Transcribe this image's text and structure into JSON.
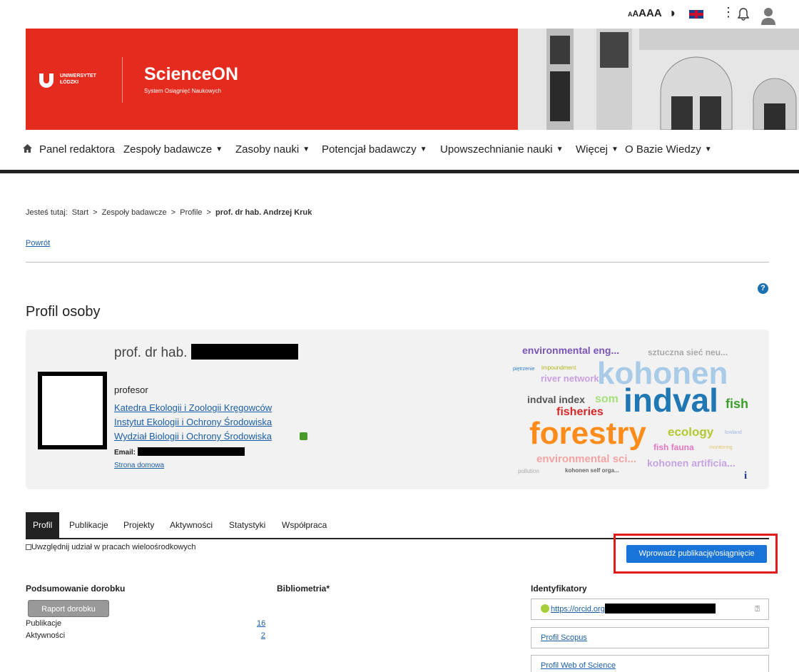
{
  "topbar": {
    "font_size": "AAA",
    "contrast": "◑",
    "menu": "⋮"
  },
  "header": {
    "logo_line1": "UNIWERSYTET",
    "logo_line2": "ŁÓDZKI",
    "brand": "ScienceON",
    "brand_sub": "System Osiągnięć Naukowych"
  },
  "nav": {
    "items": [
      {
        "label": "Panel redaktora",
        "caret": false
      },
      {
        "label": "Zespoły badawcze",
        "caret": true
      },
      {
        "label": "Zasoby nauki",
        "caret": true
      },
      {
        "label": "Potencjał badawczy",
        "caret": true
      },
      {
        "label": "Upowszechnianie nauki",
        "caret": true
      },
      {
        "label": "Więcej",
        "caret": true
      },
      {
        "label": "O Bazie Wiedzy",
        "caret": true
      }
    ]
  },
  "breadcrumb": {
    "prefix": "Jesteś tutaj:",
    "items": [
      "Start",
      "Zespoły badawcze",
      "Profile"
    ],
    "current": "prof. dr hab. Andrzej Kruk",
    "sep": ">"
  },
  "back_label": "Powrót",
  "page_title": "Profil osoby",
  "profile": {
    "name_prefix": "prof. dr hab.",
    "position": "profesor",
    "links": [
      "Katedra Ekologii i Zoologii Kręgowców",
      "Instytut Ekologii i Ochrony Środowiska",
      "Wydział Biologii i Ochrony Środowiska"
    ],
    "email_label": "Email:",
    "homepage": "Strona domowa"
  },
  "wordcloud": [
    {
      "text": "environmental eng...",
      "color": "#7a55b8"
    },
    {
      "text": "sztuczna sieć neu...",
      "color": "#a9a9a9"
    },
    {
      "text": "piętrzenie",
      "color": "#2a7fd0"
    },
    {
      "text": "impoundment",
      "color": "#b5b51a"
    },
    {
      "text": "river network",
      "color": "#c9a0e0"
    },
    {
      "text": "kohonen",
      "color": "#a9cbe8"
    },
    {
      "text": "indval index",
      "color": "#555555"
    },
    {
      "text": "som",
      "color": "#a6e07a"
    },
    {
      "text": "indval",
      "color": "#1f77b4"
    },
    {
      "text": "fish",
      "color": "#3aa02a"
    },
    {
      "text": "fisheries",
      "color": "#d62728"
    },
    {
      "text": "forestry",
      "color": "#ff8c1a"
    },
    {
      "text": "ecology",
      "color": "#b5c832"
    },
    {
      "text": "lowland",
      "color": "#9fb8e0"
    },
    {
      "text": "fish fauna",
      "color": "#e377c2"
    },
    {
      "text": "monitoring",
      "color": "#e3c66a"
    },
    {
      "text": "environmental sci...",
      "color": "#f4a3a3"
    },
    {
      "text": "kohonen artificia...",
      "color": "#c5a3e0"
    },
    {
      "text": "pollution",
      "color": "#aaaaaa"
    },
    {
      "text": "kohonen self orga...",
      "color": "#666666"
    }
  ],
  "tabs": [
    "Profil",
    "Publikacje",
    "Projekty",
    "Aktywności",
    "Statystyki",
    "Współpraca"
  ],
  "checkbox_label": "Uwzględnij udział w pracach wieloośrodkowych",
  "primary_button": "Wprowadź publikację/osiągnięcie",
  "summary": {
    "heading": "Podsumowanie dorobku",
    "button": "Raport dorobku",
    "rows": [
      {
        "label": "Publikacje",
        "value": "16"
      },
      {
        "label": "Aktywności",
        "value": "2"
      }
    ]
  },
  "bibliometrics_heading": "Bibliometria*",
  "identifiers": {
    "heading": "Identyfikatory",
    "orcid": "https://orcid.org",
    "scopus": "Profil Scopus",
    "wos": "Profil Web of Science"
  }
}
